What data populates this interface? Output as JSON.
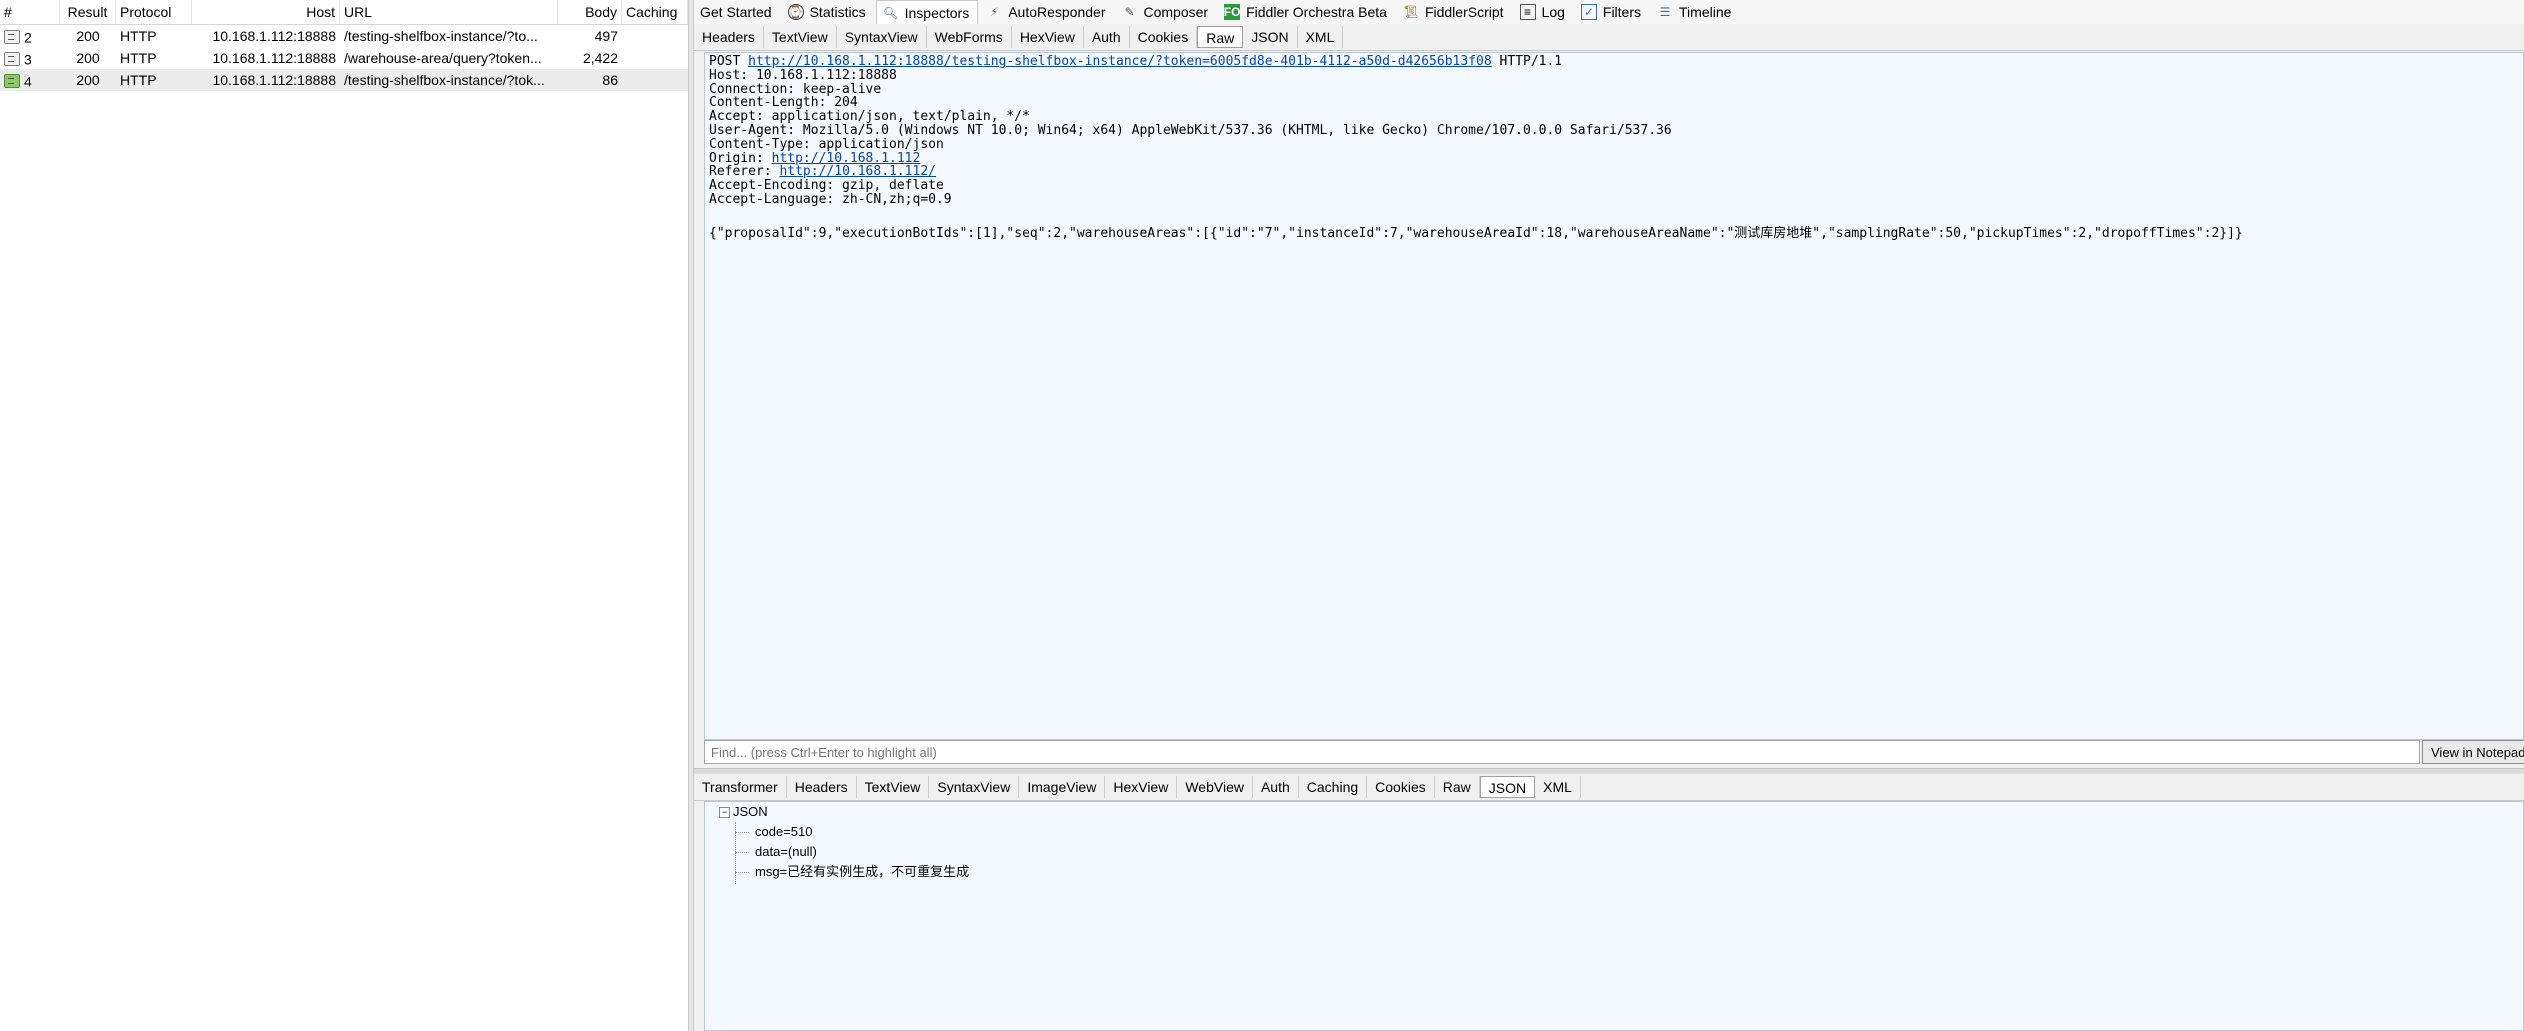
{
  "sessions": {
    "columns": {
      "num": "#",
      "result": "Result",
      "protocol": "Protocol",
      "host": "Host",
      "url": "URL",
      "body": "Body",
      "caching": "Caching"
    },
    "rows": [
      {
        "num": "2",
        "result": "200",
        "protocol": "HTTP",
        "host": "10.168.1.112:18888",
        "url": "/testing-shelfbox-instance/?to...",
        "body": "497",
        "caching": ""
      },
      {
        "num": "3",
        "result": "200",
        "protocol": "HTTP",
        "host": "10.168.1.112:18888",
        "url": "/warehouse-area/query?token...",
        "body": "2,422",
        "caching": ""
      },
      {
        "num": "4",
        "result": "200",
        "protocol": "HTTP",
        "host": "10.168.1.112:18888",
        "url": "/testing-shelfbox-instance/?tok...",
        "body": "86",
        "caching": ""
      }
    ]
  },
  "main_tabs": [
    {
      "label": "Get Started",
      "icon": ""
    },
    {
      "label": "Statistics",
      "icon": "stopwatch-icon"
    },
    {
      "label": "Inspectors",
      "icon": "magnifier-icon"
    },
    {
      "label": "AutoResponder",
      "icon": "lightning-icon"
    },
    {
      "label": "Composer",
      "icon": "pencil-icon"
    },
    {
      "label": "Fiddler Orchestra Beta",
      "icon": "fo-icon"
    },
    {
      "label": "FiddlerScript",
      "icon": "script-icon"
    },
    {
      "label": "Log",
      "icon": "log-icon"
    },
    {
      "label": "Filters",
      "icon": "checkbox-icon"
    },
    {
      "label": "Timeline",
      "icon": "timeline-icon"
    }
  ],
  "request_tabs": [
    "Headers",
    "TextView",
    "SyntaxView",
    "WebForms",
    "HexView",
    "Auth",
    "Cookies",
    "Raw",
    "JSON",
    "XML"
  ],
  "request_active_tab": "Raw",
  "raw_request": {
    "method": "POST",
    "url": "http://10.168.1.112:18888/testing-shelfbox-instance/?token=6005fd8e-401b-4112-a50d-d42656b13f08",
    "version": "HTTP/1.1",
    "host": "Host: 10.168.1.112:18888",
    "connection": "Connection: keep-alive",
    "content_length": "Content-Length: 204",
    "accept": "Accept: application/json, text/plain, */*",
    "user_agent": "User-Agent: Mozilla/5.0 (Windows NT 10.0; Win64; x64) AppleWebKit/537.36 (KHTML, like Gecko) Chrome/107.0.0.0 Safari/537.36",
    "content_type": "Content-Type: application/json",
    "origin_label": "Origin: ",
    "origin_url": "http://10.168.1.112",
    "referer_label": "Referer: ",
    "referer_url": "http://10.168.1.112/",
    "accept_encoding": "Accept-Encoding: gzip, deflate",
    "accept_language": "Accept-Language: zh-CN,zh;q=0.9",
    "body": "{\"proposalId\":9,\"executionBotIds\":[1],\"seq\":2,\"warehouseAreas\":[{\"id\":\"7\",\"instanceId\":7,\"warehouseAreaId\":18,\"warehouseAreaName\":\"测试库房地堆\",\"samplingRate\":50,\"pickupTimes\":2,\"dropoffTimes\":2}]}"
  },
  "find": {
    "placeholder": "Find... (press Ctrl+Enter to highlight all)",
    "notepad_label": "View in Notepad"
  },
  "response_tabs": [
    "Transformer",
    "Headers",
    "TextView",
    "SyntaxView",
    "ImageView",
    "HexView",
    "WebView",
    "Auth",
    "Caching",
    "Cookies",
    "Raw",
    "JSON",
    "XML"
  ],
  "response_active_tab": "JSON",
  "json_tree": {
    "root": "JSON",
    "expander": "−",
    "children": [
      "code=510",
      "data=(null)",
      "msg=已经有实例生成，不可重复生成"
    ]
  }
}
